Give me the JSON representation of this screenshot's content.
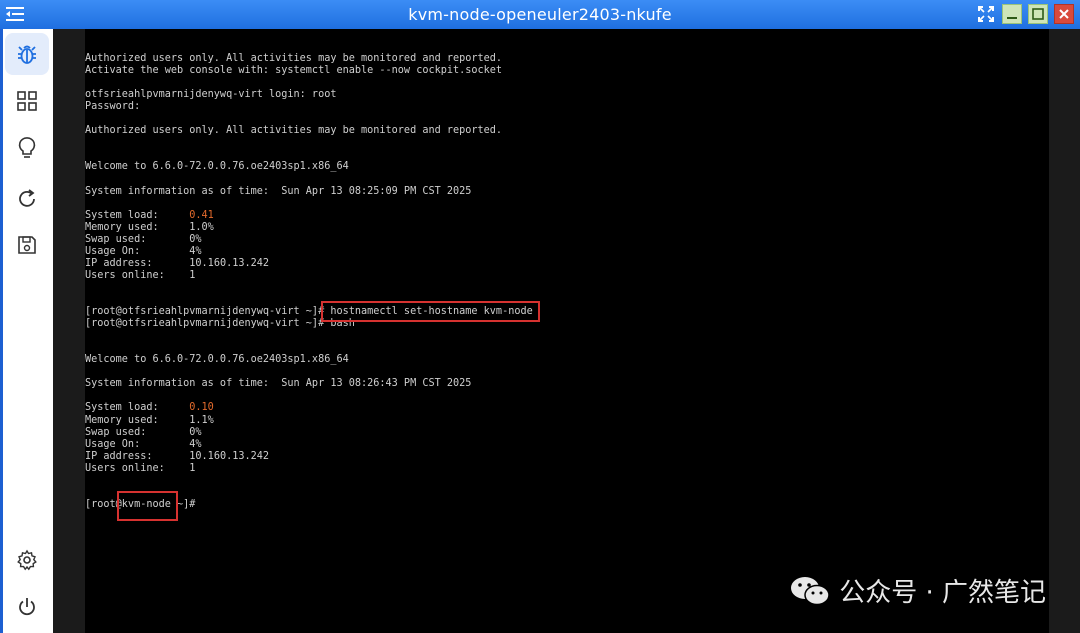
{
  "window": {
    "title": "kvm-node-openeuler2403-nkufe"
  },
  "sidebar": {
    "items": [
      {
        "icon": "bug-icon",
        "active": true
      },
      {
        "icon": "grid-icon",
        "active": false
      },
      {
        "icon": "lightbulb-icon",
        "active": false
      },
      {
        "icon": "refresh-icon",
        "active": false
      },
      {
        "icon": "save-icon",
        "active": false
      }
    ],
    "bottom": [
      {
        "icon": "gear-icon"
      },
      {
        "icon": "power-icon"
      }
    ]
  },
  "terminal": {
    "lines": [
      {
        "text": "Authorized users only. All activities may be monitored and reported."
      },
      {
        "text": "Activate the web console with: systemctl enable --now cockpit.socket"
      },
      {
        "text": ""
      },
      {
        "text": "otfsrieahlpvmarnijdenywq-virt login: root"
      },
      {
        "text": "Password:"
      },
      {
        "text": ""
      },
      {
        "text": "Authorized users only. All activities may be monitored and reported."
      },
      {
        "text": ""
      },
      {
        "text": ""
      },
      {
        "text": "Welcome to 6.6.0-72.0.0.76.oe2403sp1.x86_64"
      },
      {
        "text": ""
      },
      {
        "text": "System information as of time:  Sun Apr 13 08:25:09 PM CST 2025"
      },
      {
        "text": ""
      },
      {
        "label": "System load:     ",
        "value": "0.41",
        "highlight": true
      },
      {
        "label": "Memory used:     ",
        "value": "1.0%"
      },
      {
        "label": "Swap used:       ",
        "value": "0%"
      },
      {
        "label": "Usage On:        ",
        "value": "4%"
      },
      {
        "label": "IP address:      ",
        "value": "10.160.13.242"
      },
      {
        "label": "Users online:    ",
        "value": "1"
      },
      {
        "text": ""
      },
      {
        "text": ""
      },
      {
        "text": "[root@otfsrieahlpvmarnijdenywq-virt ~]# hostnamectl set-hostname kvm-node"
      },
      {
        "text": "[root@otfsrieahlpvmarnijdenywq-virt ~]# bash"
      },
      {
        "text": ""
      },
      {
        "text": ""
      },
      {
        "text": "Welcome to 6.6.0-72.0.0.76.oe2403sp1.x86_64"
      },
      {
        "text": ""
      },
      {
        "text": "System information as of time:  Sun Apr 13 08:26:43 PM CST 2025"
      },
      {
        "text": ""
      },
      {
        "label": "System load:     ",
        "value": "0.10",
        "highlight": true
      },
      {
        "label": "Memory used:     ",
        "value": "1.1%"
      },
      {
        "label": "Swap used:       ",
        "value": "0%"
      },
      {
        "label": "Usage On:        ",
        "value": "4%"
      },
      {
        "label": "IP address:      ",
        "value": "10.160.13.242"
      },
      {
        "label": "Users online:    ",
        "value": "1"
      },
      {
        "text": ""
      },
      {
        "text": ""
      },
      {
        "text": "[root@kvm-node ~]#"
      }
    ]
  },
  "watermark": {
    "text": "公众号 · 广然笔记"
  },
  "colors": {
    "titlebar": "#2a7ff0",
    "highlight": "#e26a2c",
    "annotation": "#d63230"
  }
}
